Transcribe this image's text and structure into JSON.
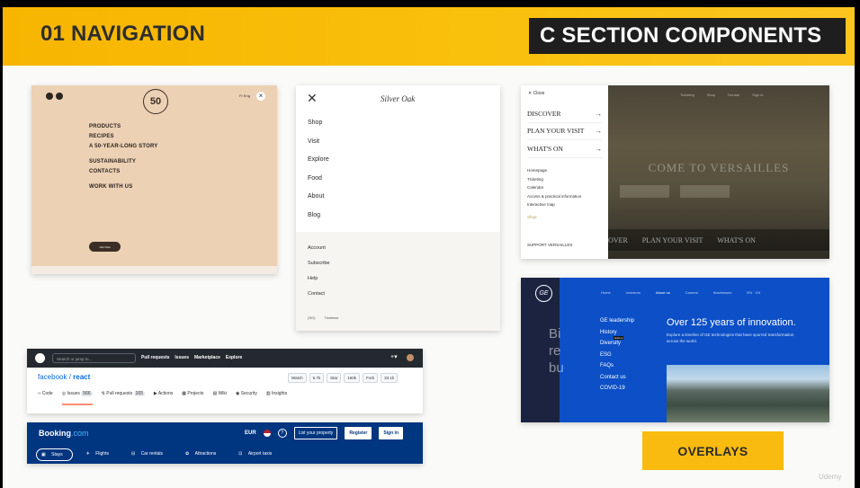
{
  "banner": {
    "left_title": "01 NAVIGATION",
    "right_title": "C SECTION COMPONENTS"
  },
  "card1": {
    "menu": [
      "PRODUCTS",
      "RECIPES",
      "A 50-YEAR-LONG STORY",
      "SUSTAINABILITY",
      "CONTACTS",
      "WORK WITH US"
    ],
    "logo": "50",
    "lang": "Fr Eng",
    "pill": "Join Now"
  },
  "card2": {
    "brand": "Silver Oak",
    "main": [
      "Shop",
      "Visit",
      "Explore",
      "Food",
      "About",
      "Blog"
    ],
    "sub": [
      "Account",
      "Subscribe",
      "Help",
      "Contact"
    ],
    "foot": [
      "(SO)",
      "Timeless"
    ]
  },
  "card3": {
    "close": "Close",
    "big": [
      "DISCOVER",
      "PLAN YOUR VISIT",
      "WHAT'S ON"
    ],
    "small": [
      "Homepage",
      "Ticketing",
      "Calendar",
      "Access & practical information",
      "Interactive map"
    ],
    "shop": "Shop",
    "support": "SUPPORT VERSAILLES",
    "photo_title": "COME TO VERSAILLES",
    "photo_nav": [
      "OVER",
      "PLAN YOUR VISIT",
      "WHAT'S ON"
    ],
    "photo_top": [
      "Ticketing",
      "Shop",
      "Donate",
      "Sign in"
    ]
  },
  "card4": {
    "search": "Search or jump to...",
    "links": [
      "Pull requests",
      "Issues",
      "Marketplace",
      "Explore"
    ],
    "repo_owner": "facebook",
    "repo_sep": " / ",
    "repo_name": "react",
    "actions": [
      "Watch",
      "6.7k",
      "Star",
      "160k",
      "Fork",
      "33.1k"
    ],
    "tabs": [
      {
        "label": "Code"
      },
      {
        "label": "Issues",
        "count": "566"
      },
      {
        "label": "Pull requests",
        "count": "165"
      },
      {
        "label": "Actions"
      },
      {
        "label": "Projects"
      },
      {
        "label": "Wiki"
      },
      {
        "label": "Security"
      },
      {
        "label": "Insights"
      }
    ]
  },
  "card5": {
    "logo": "Booking",
    "logo_suffix": ".com",
    "currency": "EUR",
    "help": "?",
    "list_property": "List your property",
    "register": "Register",
    "signin": "Sign in",
    "tabs": [
      "Stays",
      "Flights",
      "Car rentals",
      "Attractions",
      "Airport taxis"
    ]
  },
  "card6": {
    "logo": "GE",
    "side_text": "Bi re bu",
    "topnav": [
      "Home",
      "Investors",
      "About us",
      "Careers",
      "Businesses",
      "EN · CN"
    ],
    "sub": [
      "GE leadership",
      "History",
      "Diversity",
      "ESG",
      "FAQs",
      "Contact us",
      "COVID-19"
    ],
    "heading": "Over 125 years of innovation.",
    "para": "Explore a timeline of GE technologies that have spurred transformation across the world.",
    "hover_badge": "History"
  },
  "overlays": "OVERLAYS",
  "watermark": "Udemy"
}
